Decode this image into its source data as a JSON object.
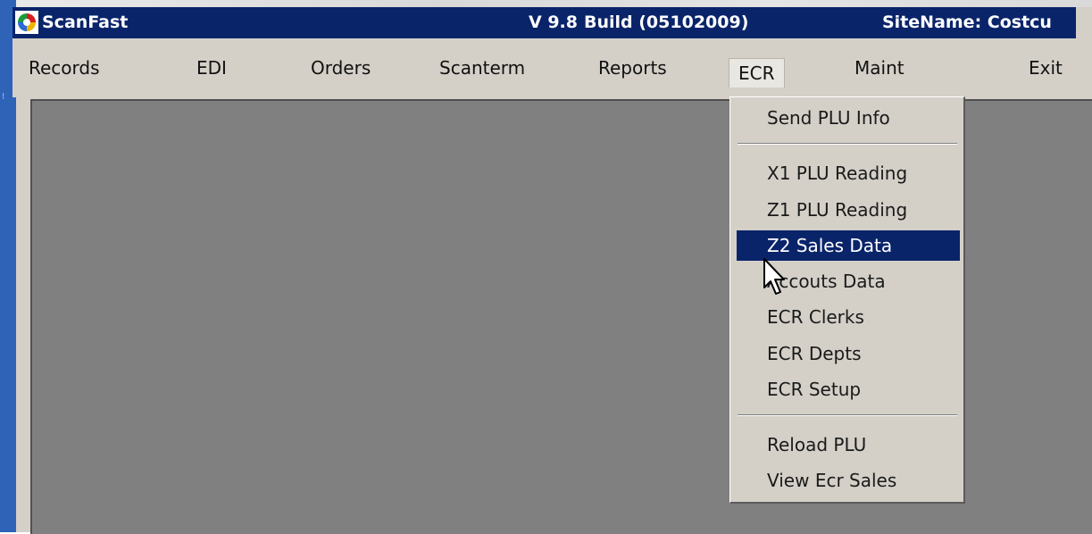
{
  "window": {
    "app_title": "ScanFast",
    "version": "V 9.8",
    "build": "Build (05102009)",
    "site": "SiteName: Costcu"
  },
  "menu": {
    "items": [
      {
        "label": "Records",
        "key": "records"
      },
      {
        "label": "EDI",
        "key": "edi"
      },
      {
        "label": "Orders",
        "key": "orders"
      },
      {
        "label": "Scanterm",
        "key": "scanterm"
      },
      {
        "label": "Reports",
        "key": "reports"
      },
      {
        "label": "ECR",
        "key": "ecr",
        "active": true
      },
      {
        "label": "Maint",
        "key": "maint"
      },
      {
        "label": "Exit",
        "key": "exit"
      }
    ]
  },
  "ecr_menu": {
    "items": [
      {
        "label": "Send PLU Info"
      },
      {
        "label": "X1 PLU Reading"
      },
      {
        "label": "Z1 PLU Reading"
      },
      {
        "label": "Z2 Sales Data",
        "highlighted": true
      },
      {
        "label": "Accouts Data"
      },
      {
        "label": "ECR Clerks"
      },
      {
        "label": "ECR Depts"
      },
      {
        "label": "ECR Setup"
      },
      {
        "label": "Reload PLU"
      },
      {
        "label": "View Ecr Sales"
      }
    ]
  },
  "icons": {
    "app": "scanfast-logo-icon",
    "pointer": "mouse-pointer-icon"
  },
  "colors": {
    "titlebar": "#0a246a",
    "menu_highlight": "#0a246a",
    "menu_background": "#d4d0c8",
    "workspace": "#808080",
    "desktop_strip": "#2f63b8"
  }
}
